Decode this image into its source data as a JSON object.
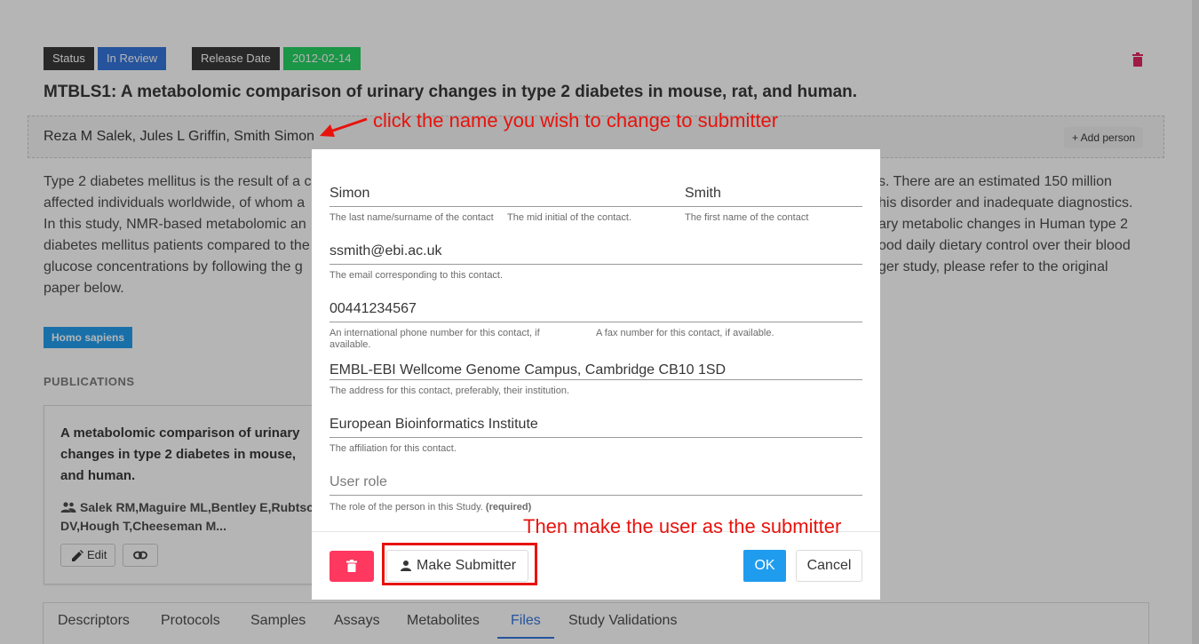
{
  "status": {
    "label": "Status",
    "value": "In Review"
  },
  "release": {
    "label": "Release Date",
    "value": "2012-02-14"
  },
  "study_title": "MTBLS1: A metabolomic comparison of urinary changes in type 2 diabetes in mouse, rat, and human.",
  "authors": "Reza M Salek, Jules L Griffin, Smith Simon",
  "add_person_label": "+ Add person",
  "abstract_left": [
    "Type 2 diabetes mellitus is the result of a c",
    "affected individuals worldwide, of whom a",
    "In this study, NMR-based metabolomic an",
    "diabetes mellitus patients compared to the",
    "glucose concentrations by following the g",
    "paper below."
  ],
  "abstract_right": [
    "s. There are an estimated 150 million",
    "his disorder and inadequate diagnostics.",
    "ary metabolic changes in Human type 2",
    "ood daily dietary control over their blood",
    "ger study, please refer to the original",
    ""
  ],
  "organism": "Homo sapiens",
  "publications_heading": "PUBLICATIONS",
  "publication": {
    "title": "A metabolomic comparison of urinary changes in type 2 diabetes in mouse, and human.",
    "title_lines": [
      "A metabolomic comparison of urinary",
      "changes in type 2 diabetes in mouse,",
      "and human."
    ],
    "authors_lines": [
      "Salek RM,Maguire ML,Bentley E,Rubtso",
      "DV,Hough T,Cheeseman M..."
    ],
    "edit_label": "Edit"
  },
  "tabs": [
    {
      "label": "Descriptors"
    },
    {
      "label": "Protocols"
    },
    {
      "label": "Samples"
    },
    {
      "label": "Assays"
    },
    {
      "label": "Metabolites"
    },
    {
      "label": "Files",
      "active": true
    },
    {
      "label": "Study Validations"
    }
  ],
  "modal": {
    "last_name": {
      "value": "Simon",
      "help": "The last name/surname of the contact"
    },
    "mid_initial": {
      "value": "",
      "help": "The mid initial of the contact."
    },
    "first_name": {
      "value": "Smith",
      "help": "The first name of the contact"
    },
    "email": {
      "value": "ssmith@ebi.ac.uk",
      "help": "The email corresponding to this contact."
    },
    "phone": {
      "value": "00441234567",
      "help": "An international phone number for this contact, if available."
    },
    "fax": {
      "value": "",
      "help": "A fax number for this contact, if available."
    },
    "address": {
      "value": "EMBL-EBI Wellcome Genome Campus, Cambridge CB10 1SD",
      "help": "The address for this contact, preferably, their institution."
    },
    "affiliation": {
      "value": "European Bioinformatics Institute",
      "help": "The affiliation for this contact."
    },
    "role": {
      "placeholder": "User role",
      "help": "The role of the person in this Study.",
      "required": "(required)"
    },
    "make_submitter_label": "Make Submitter",
    "ok_label": "OK",
    "cancel_label": "Cancel"
  },
  "annotations": {
    "top": "click the name you wish to change to submitter",
    "bottom": "Then make the user as the submitter"
  },
  "colors": {
    "status_blue": "#3273dc",
    "release_green": "#23d160",
    "annotation_red": "#e8120c",
    "ok_button": "#209cee",
    "delete_button": "#ff3860"
  },
  "icons": [
    "trash-icon",
    "people-icon",
    "pencil-icon",
    "link-icon",
    "person-icon",
    "arrow-icon"
  ]
}
